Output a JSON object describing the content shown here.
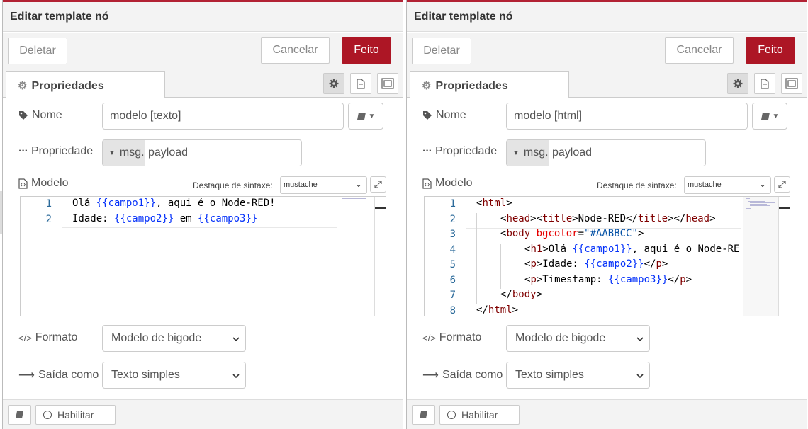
{
  "panels": [
    {
      "title": "Editar template nó",
      "buttons": {
        "delete": "Deletar",
        "cancel": "Cancelar",
        "done": "Feito"
      },
      "tab": "Propriedades",
      "name_label": "Nome",
      "name_value": "modelo [texto]",
      "property_label": "Propriedade",
      "property_type": "msg.",
      "property_value": "payload",
      "template_label": "Modelo",
      "syntax_label": "Destaque de sintaxe:",
      "syntax_value": "mustache",
      "code_lines": [
        {
          "num": "1",
          "text": "Olá {{campo1}}, aqui é o Node-RED!"
        },
        {
          "num": "2",
          "text": "Idade: {{campo2}} em {{campo3}}"
        }
      ],
      "format_label": "Formato",
      "format_value": "Modelo de bigode",
      "output_label": "Saída como",
      "output_value": "Texto simples",
      "enable_label": "Habilitar"
    },
    {
      "title": "Editar template nó",
      "buttons": {
        "delete": "Deletar",
        "cancel": "Cancelar",
        "done": "Feito"
      },
      "tab": "Propriedades",
      "name_label": "Nome",
      "name_value": "modelo [html]",
      "property_label": "Propriedade",
      "property_type": "msg.",
      "property_value": "payload",
      "template_label": "Modelo",
      "syntax_label": "Destaque de sintaxe:",
      "syntax_value": "mustache",
      "code_lines": [
        {
          "num": "1",
          "text": "<html>"
        },
        {
          "num": "2",
          "text": "<head><title>Node-RED</title></head>"
        },
        {
          "num": "3",
          "text": "<body bgcolor=\"#AABBCC\">"
        },
        {
          "num": "4",
          "text": "<h1>Olá {{campo1}}, aqui é o Node-RE"
        },
        {
          "num": "5",
          "text": "<p>Idade: {{campo2}}</p>"
        },
        {
          "num": "6",
          "text": "<p>Timestamp: {{campo3}}</p>"
        },
        {
          "num": "7",
          "text": "</body>"
        },
        {
          "num": "8",
          "text": "</html>"
        }
      ],
      "format_label": "Formato",
      "format_value": "Modelo de bigode",
      "output_label": "Saída como",
      "output_value": "Texto simples",
      "enable_label": "Habilitar"
    }
  ],
  "colors": {
    "accent": "#ad1625",
    "line_numbers": "#2b6a9a",
    "mustache": "#0431fa",
    "html_tag": "#800000",
    "html_attr": "#e50000"
  }
}
